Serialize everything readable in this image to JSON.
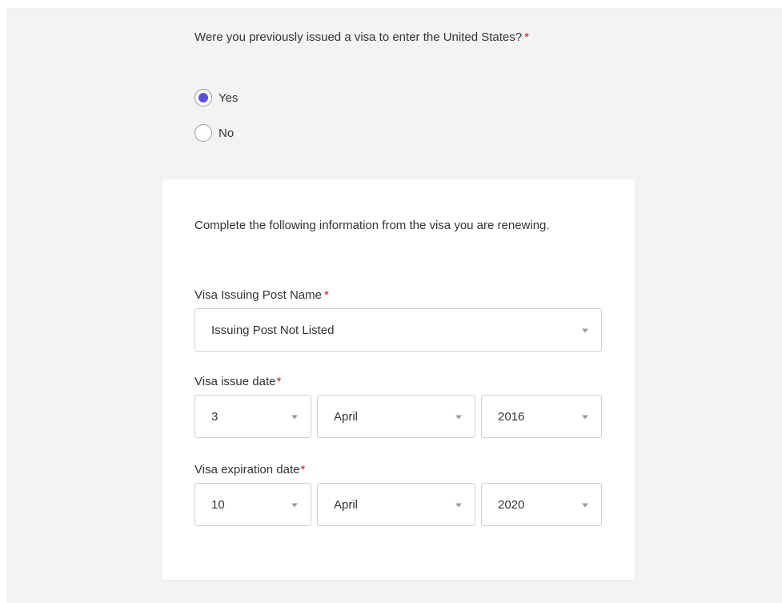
{
  "question": {
    "text": "Were you previously issued a visa to enter the United States?",
    "required_mark": "*"
  },
  "radio_options": [
    {
      "label": "Yes",
      "selected": true
    },
    {
      "label": "No",
      "selected": false
    }
  ],
  "section": {
    "intro": "Complete the following information from the visa you are renewing.",
    "issuing_post": {
      "label": "Visa Issuing Post Name",
      "required_mark": "*",
      "value": "Issuing Post Not Listed"
    },
    "issue_date": {
      "label": "Visa issue date",
      "required_mark": "*",
      "day": "3",
      "month": "April",
      "year": "2016"
    },
    "expiration_date": {
      "label": "Visa expiration date",
      "required_mark": "*",
      "day": "10",
      "month": "April",
      "year": "2020"
    }
  },
  "icons": {
    "dropdown": "chevron-down-icon"
  },
  "colors": {
    "accent": "#5b4fd6",
    "required": "#c8102e",
    "background": "#f3f3f3",
    "card": "#ffffff"
  }
}
